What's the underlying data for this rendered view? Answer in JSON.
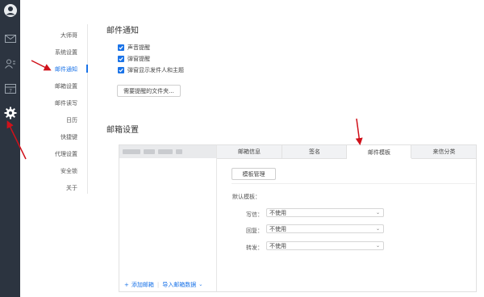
{
  "nav": {
    "items": [
      "大师哥",
      "系统设置",
      "邮件通知",
      "邮箱设置",
      "邮件读写",
      "日历",
      "快捷键",
      "代理设置",
      "安全锁",
      "关于"
    ],
    "active_index": 2
  },
  "notify": {
    "title": "邮件通知",
    "options": [
      "声音提醒",
      "弹窗提醒",
      "弹窗显示发件人和主题"
    ],
    "folder_button": "需要提醒的文件夹..."
  },
  "mailbox": {
    "title": "邮箱设置",
    "tabs": [
      "邮箱信息",
      "签名",
      "邮件模板",
      "来信分类"
    ],
    "active_tab": 2,
    "manage_button": "模板管理",
    "default_label": "默认模板：",
    "rows": [
      {
        "label": "写信：",
        "value": "不使用"
      },
      {
        "label": "回复：",
        "value": "不使用"
      },
      {
        "label": "转发：",
        "value": "不使用"
      }
    ],
    "add_account": "添加邮箱",
    "import_data": "导入邮箱数据"
  },
  "colors": {
    "accent": "#1a73e8",
    "rail": "#2c3440",
    "annotation": "#d0121b"
  }
}
